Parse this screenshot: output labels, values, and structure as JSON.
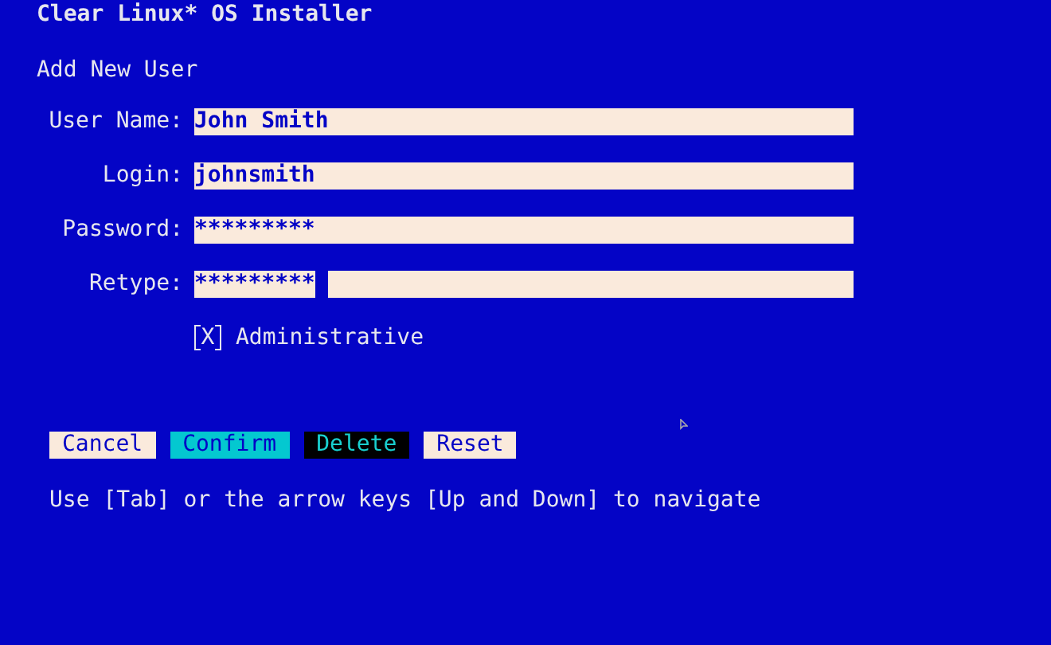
{
  "window": {
    "title": "Clear Linux* OS Installer"
  },
  "heading": "Add New User",
  "fields": [
    {
      "label": "User Name:",
      "value": "John Smith",
      "focused": false
    },
    {
      "label": "Login:",
      "value": "johnsmith",
      "focused": false
    },
    {
      "label": "Password:",
      "value": "*********",
      "focused": false
    },
    {
      "label": "Retype:",
      "value": "*********",
      "focused": true
    }
  ],
  "checkbox": {
    "label": "Administrative",
    "checked": true,
    "mark": "X"
  },
  "buttons": [
    {
      "label": "Cancel",
      "kind": "normal"
    },
    {
      "label": "Confirm",
      "kind": "focused"
    },
    {
      "label": "Delete",
      "kind": "inverse"
    },
    {
      "label": "Reset",
      "kind": "normal"
    }
  ],
  "hint": "Use [Tab] or the arrow keys [Up and Down] to navigate"
}
